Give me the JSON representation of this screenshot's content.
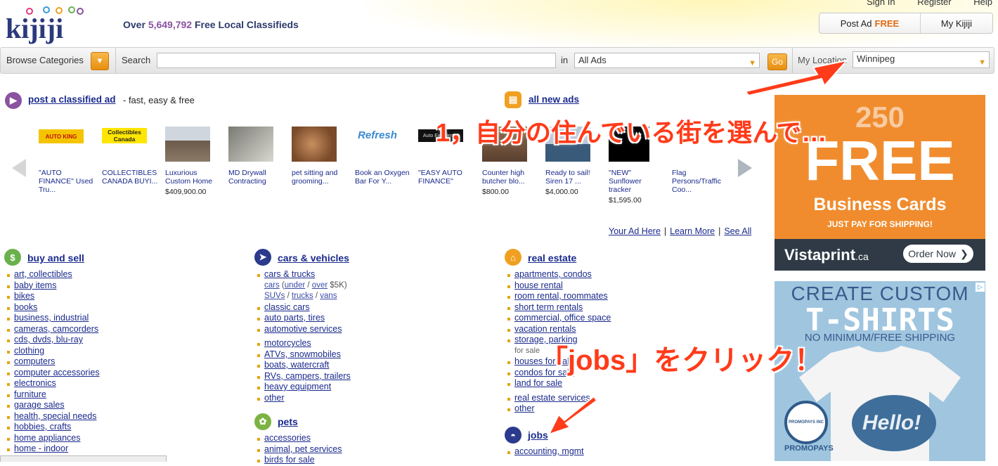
{
  "header": {
    "logo_text": "kijiji",
    "tagline_pre": "Over",
    "tagline_count": "5,649,792",
    "tagline_post": "Free Local Classifieds",
    "top_links": [
      "Sign In",
      "Register",
      "Help"
    ],
    "post_ad_label": "Post Ad",
    "post_ad_free": "FREE",
    "my_kijiji_label": "My Kijiji"
  },
  "searchbar": {
    "browse_label": "Browse Categories",
    "search_label": "Search",
    "search_value": "",
    "in_label": "in",
    "category_value": "All Ads",
    "go_label": "Go",
    "location_label": "My Location",
    "location_value": "Winnipeg"
  },
  "post_ad": {
    "link": "post a classified ad",
    "sub": "- fast, easy & free"
  },
  "all_new_ads": {
    "link": "all new ads"
  },
  "carousel": {
    "items": [
      {
        "title": "\"AUTO FINANCE\" Used Tru...",
        "price": ""
      },
      {
        "title": "COLLECTIBLES CANADA BUYI...",
        "price": ""
      },
      {
        "title": "Luxurious Custom Home",
        "price": "$409,900.00"
      },
      {
        "title": "MD Drywall Contracting",
        "price": ""
      },
      {
        "title": "pet sitting and grooming...",
        "price": ""
      },
      {
        "title": "Book an Oxygen Bar For Y...",
        "price": ""
      },
      {
        "title": "\"EASY AUTO FINANCE\"",
        "price": ""
      },
      {
        "title": "Counter high butcher blo...",
        "price": "$800.00"
      },
      {
        "title": "Ready to sail! Siren 17 ...",
        "price": "$4,000.00"
      },
      {
        "title": "\"NEW\" Sunflower tracker",
        "price": "$1,595.00"
      },
      {
        "title": "Flag Persons/Traffic Coo...",
        "price": ""
      }
    ],
    "thumb_texts": [
      "AUTO KING",
      "Collectibles Canada",
      "Refresh",
      "Auto Excellence"
    ],
    "footer": [
      "Your Ad Here",
      "Learn More",
      "See All"
    ]
  },
  "categories": {
    "buy_sell": {
      "title": "buy and sell",
      "items": [
        "art, collectibles",
        "baby items",
        "bikes",
        "books",
        "business, industrial",
        "cameras, camcorders",
        "cds, dvds, blu-ray",
        "clothing",
        "computers",
        "computer accessories",
        "electronics",
        "furniture",
        "garage sales",
        "health, special needs",
        "hobbies, crafts",
        "home appliances",
        "home - indoor"
      ]
    },
    "cars": {
      "title": "cars & vehicles",
      "item1": "cars & trucks",
      "sub1": {
        "cars": "cars",
        "under": "under",
        "slash": "/",
        "over": "over",
        "price": "$5K"
      },
      "sub2": {
        "suvs": "SUVs",
        "trucks": "trucks",
        "vans": "vans"
      },
      "items_a": [
        "classic cars",
        "auto parts, tires",
        "automotive services"
      ],
      "items_b": [
        "motorcycles",
        "ATVs, snowmobiles",
        "boats, watercraft",
        "RVs, campers, trailers",
        "heavy equipment",
        "other"
      ]
    },
    "pets": {
      "title": "pets",
      "items": [
        "accessories",
        "animal, pet services",
        "birds for sale"
      ]
    },
    "real_estate": {
      "title": "real estate",
      "items_a": [
        "apartments, condos",
        "house rental",
        "room rental, roommates",
        "short term rentals",
        "commercial, office space",
        "vacation rentals",
        "storage, parking"
      ],
      "for_sale_note": "for sale",
      "items_b": [
        "houses for sale",
        "condos for sale",
        "land for sale"
      ],
      "items_c": [
        "real estate services",
        "other"
      ]
    },
    "jobs": {
      "title": "jobs",
      "items": [
        "accounting, mgmt"
      ]
    }
  },
  "ads": {
    "vistaprint": {
      "number": "250",
      "free": "FREE",
      "business_cards": "Business Cards",
      "shipping": "JUST PAY FOR SHIPPING!",
      "brand": "Vistaprint",
      "brand_suffix": ".ca",
      "order_now": "Order Now"
    },
    "promopays": {
      "line1": "CREATE CUSTOM",
      "line2": "T-SHIRTS",
      "line3": "NO MINIMUM/FREE SHIPPING",
      "shirt_text": "Hello!",
      "brand": "PROMOPAYS",
      "seal": "PROMOPAYS INC"
    }
  },
  "annotations": {
    "note1": "1，自分の住んでいる街を選んで…",
    "note2": "「jobs」をクリック！"
  },
  "colors": {
    "link": "#1a2a8c",
    "accent_orange": "#e88e10",
    "annotation_red": "#ff3b1a",
    "ad_orange": "#f08c2e"
  }
}
